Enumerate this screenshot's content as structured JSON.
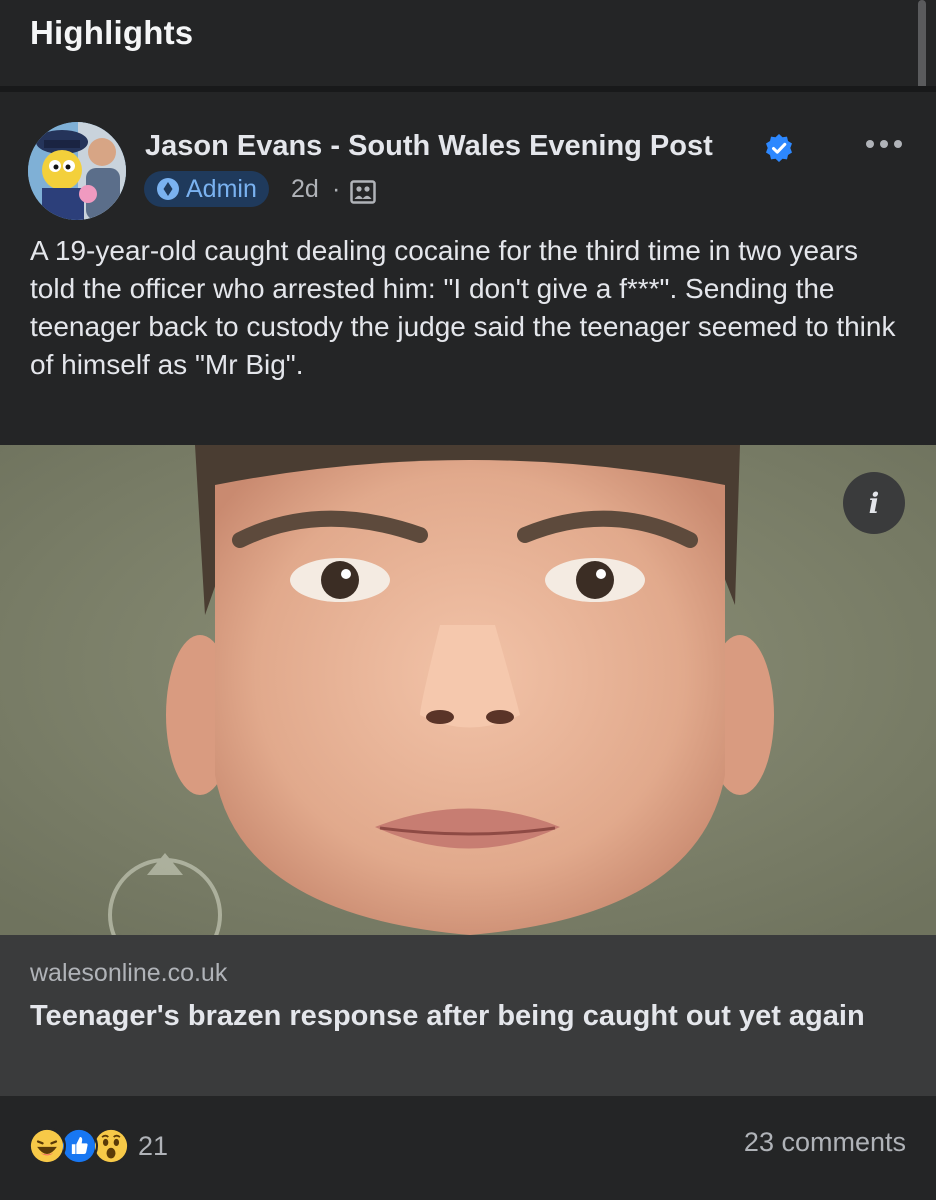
{
  "header": {
    "title": "Highlights"
  },
  "post": {
    "author": "Jason Evans - South Wales Evening Post",
    "badge": "Admin",
    "time": "2d",
    "separator": "·",
    "audience_icon": "group-photo-icon",
    "text": "A 19-year-old caught dealing cocaine for the third time in two years told the officer who arrested him: \"I don't give a f***\". Sending the teenager back to custody the judge said the teenager seemed to think of himself as \"Mr Big\".",
    "link": {
      "domain": "walesonline.co.uk",
      "title": "Teenager's brazen response after being caught out yet again",
      "info_label": "i"
    },
    "reactions": {
      "icons": [
        "laugh-reaction-icon",
        "like-reaction-icon",
        "wow-reaction-icon"
      ],
      "count": "21"
    },
    "comments": "23 comments"
  },
  "colors": {
    "background": "#242526",
    "card": "#3a3b3c",
    "verified": "#2d88ff",
    "admin_text": "#7ab2f0"
  }
}
